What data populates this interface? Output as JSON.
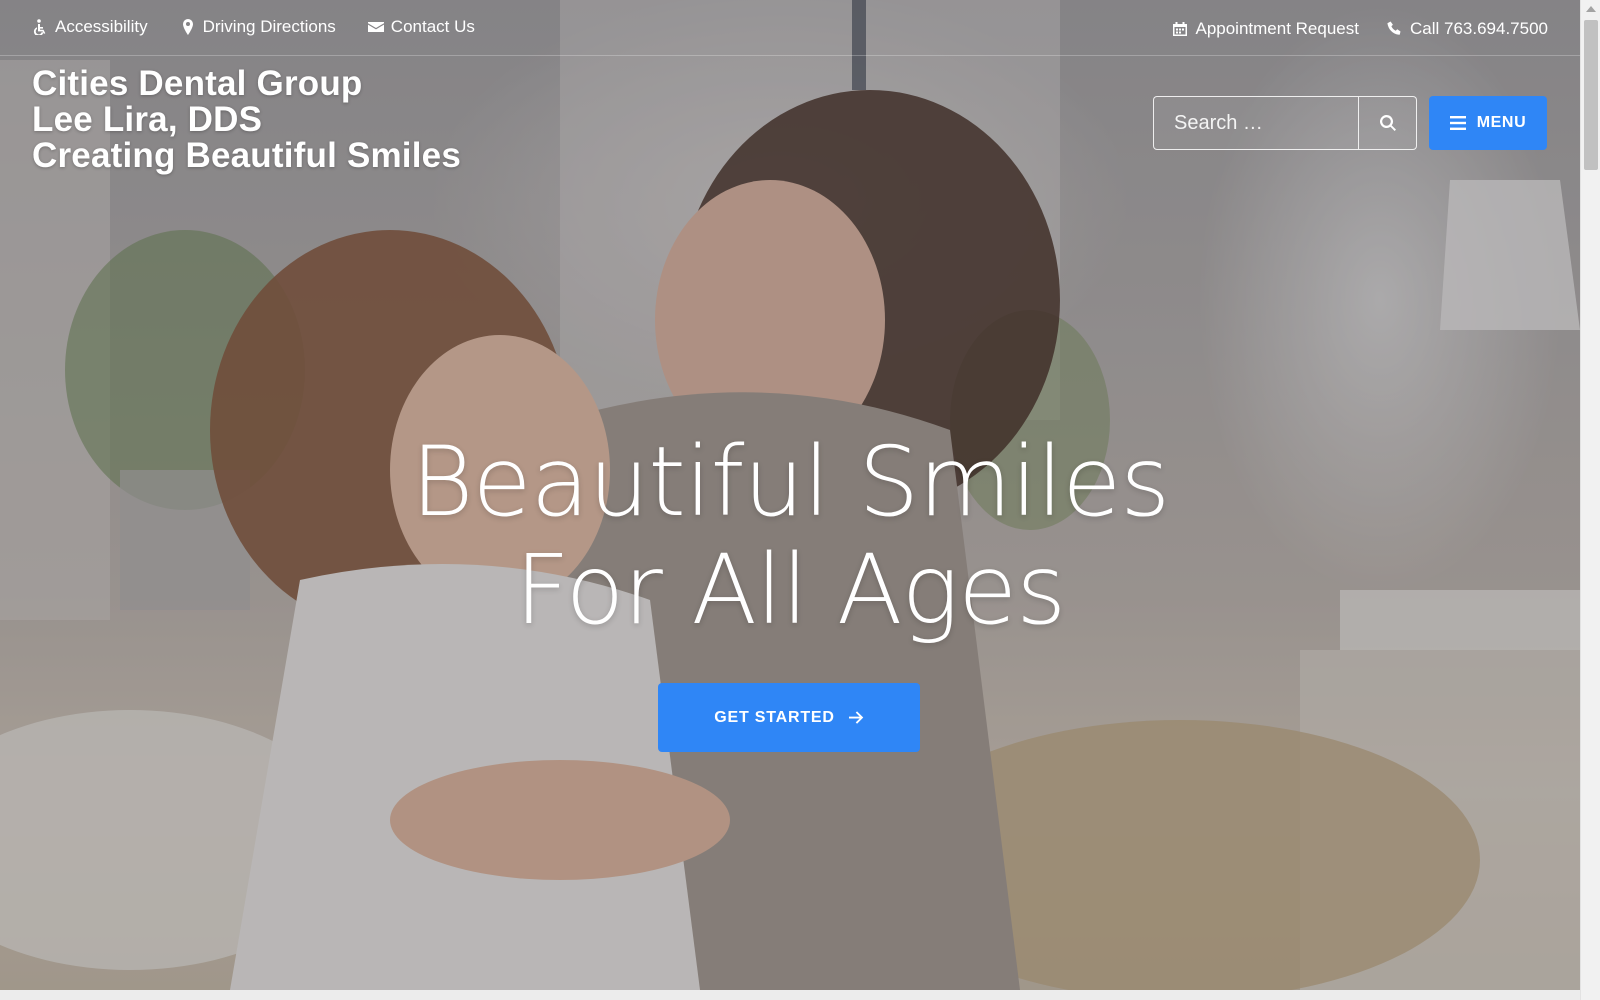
{
  "utility": {
    "left_links": [
      {
        "label": "Accessibility",
        "icon": "wheelchair-icon"
      },
      {
        "label": "Driving Directions",
        "icon": "map-marker-icon"
      },
      {
        "label": "Contact Us",
        "icon": "envelope-icon"
      }
    ],
    "right_links": [
      {
        "label": "Appointment Request",
        "icon": "calendar-icon"
      },
      {
        "label": "Call 763.694.7500",
        "icon": "phone-icon"
      }
    ]
  },
  "brand": {
    "line1": "Cities Dental Group",
    "line2": "Lee Lira, DDS",
    "line3": "Creating Beautiful Smiles"
  },
  "search": {
    "placeholder": "Search …",
    "button_icon": "search-icon"
  },
  "menu": {
    "label": "MENU",
    "icon": "hamburger-icon"
  },
  "hero": {
    "headline_line1": "Beautiful Smiles",
    "headline_line2": "For All Ages",
    "cta_label": "GET STARTED",
    "cta_icon": "arrow-right-icon"
  },
  "colors": {
    "accent": "#2f86f6",
    "text": "#ffffff"
  }
}
